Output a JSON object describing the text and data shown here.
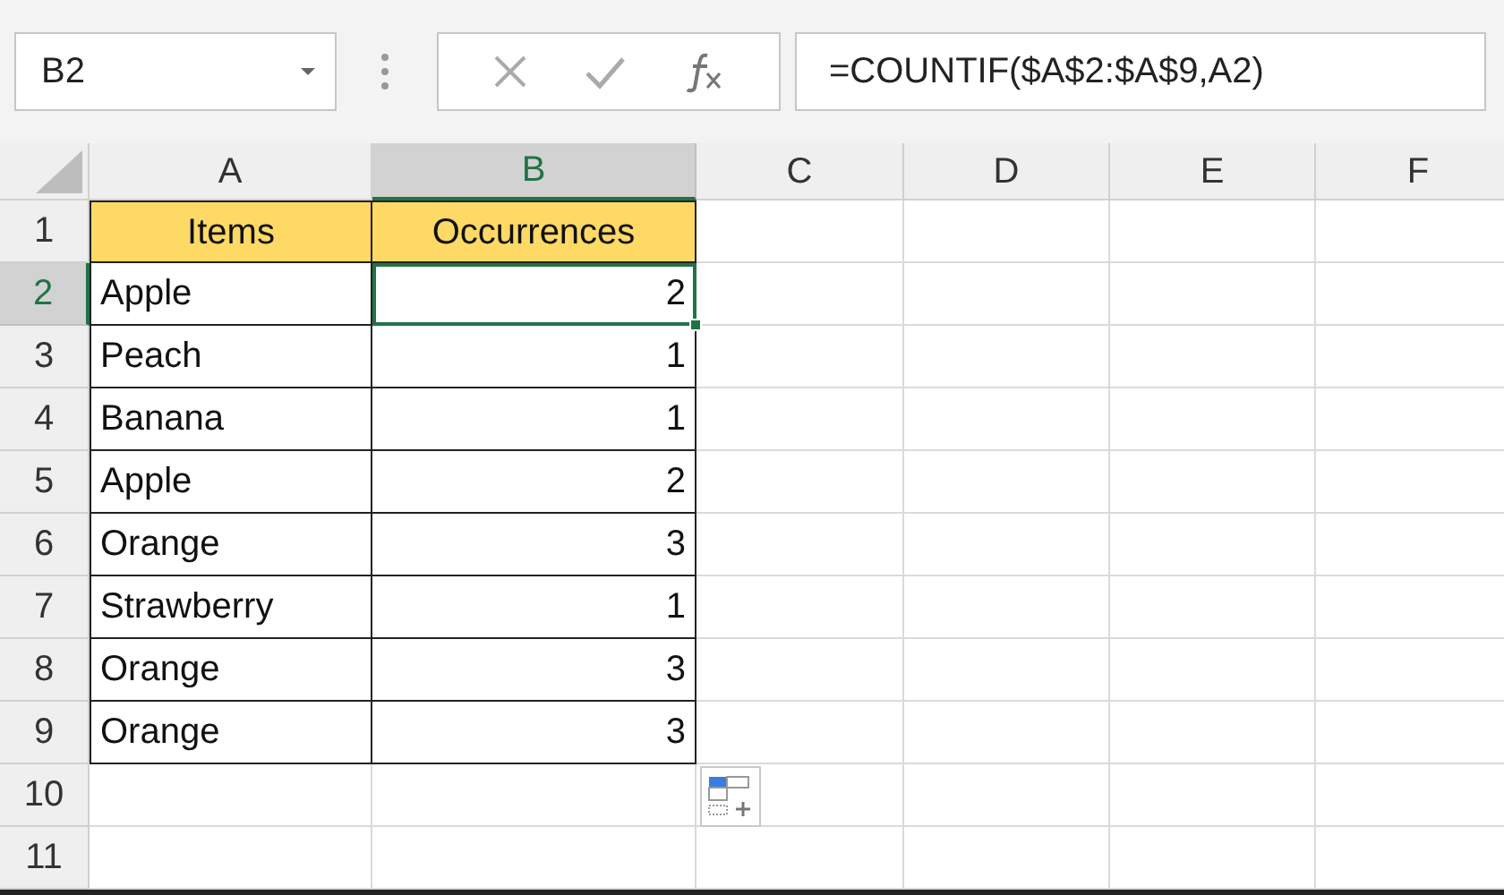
{
  "name_box": "B2",
  "formula_bar": {
    "formula": "=COUNTIF($A$2:$A$9,A2)"
  },
  "columns": [
    {
      "label": "A",
      "selected": false
    },
    {
      "label": "B",
      "selected": true
    },
    {
      "label": "C",
      "selected": false
    },
    {
      "label": "D",
      "selected": false
    },
    {
      "label": "E",
      "selected": false
    },
    {
      "label": "F",
      "selected": false
    }
  ],
  "rows": [
    {
      "number": "1",
      "selected": false,
      "cells": [
        {
          "kind": "header",
          "text": "Items",
          "selected": false
        },
        {
          "kind": "header",
          "text": "Occurrences",
          "selected": false
        }
      ]
    },
    {
      "number": "2",
      "selected": true,
      "cells": [
        {
          "kind": "text",
          "text": "Apple",
          "selected": false
        },
        {
          "kind": "number",
          "text": "2",
          "selected": true
        }
      ]
    },
    {
      "number": "3",
      "selected": false,
      "cells": [
        {
          "kind": "text",
          "text": "Peach",
          "selected": false
        },
        {
          "kind": "number",
          "text": "1",
          "selected": false
        }
      ]
    },
    {
      "number": "4",
      "selected": false,
      "cells": [
        {
          "kind": "text",
          "text": "Banana",
          "selected": false
        },
        {
          "kind": "number",
          "text": "1",
          "selected": false
        }
      ]
    },
    {
      "number": "5",
      "selected": false,
      "cells": [
        {
          "kind": "text",
          "text": "Apple",
          "selected": false
        },
        {
          "kind": "number",
          "text": "2",
          "selected": false
        }
      ]
    },
    {
      "number": "6",
      "selected": false,
      "cells": [
        {
          "kind": "text",
          "text": "Orange",
          "selected": false
        },
        {
          "kind": "number",
          "text": "3",
          "selected": false
        }
      ]
    },
    {
      "number": "7",
      "selected": false,
      "cells": [
        {
          "kind": "text",
          "text": "Strawberry",
          "selected": false
        },
        {
          "kind": "number",
          "text": "1",
          "selected": false
        }
      ]
    },
    {
      "number": "8",
      "selected": false,
      "cells": [
        {
          "kind": "text",
          "text": "Orange",
          "selected": false
        },
        {
          "kind": "number",
          "text": "3",
          "selected": false
        }
      ]
    },
    {
      "number": "9",
      "selected": false,
      "cells": [
        {
          "kind": "text",
          "text": "Orange",
          "selected": false
        },
        {
          "kind": "number",
          "text": "3",
          "selected": false
        }
      ]
    },
    {
      "number": "10",
      "selected": false
    },
    {
      "number": "11",
      "selected": false
    }
  ]
}
